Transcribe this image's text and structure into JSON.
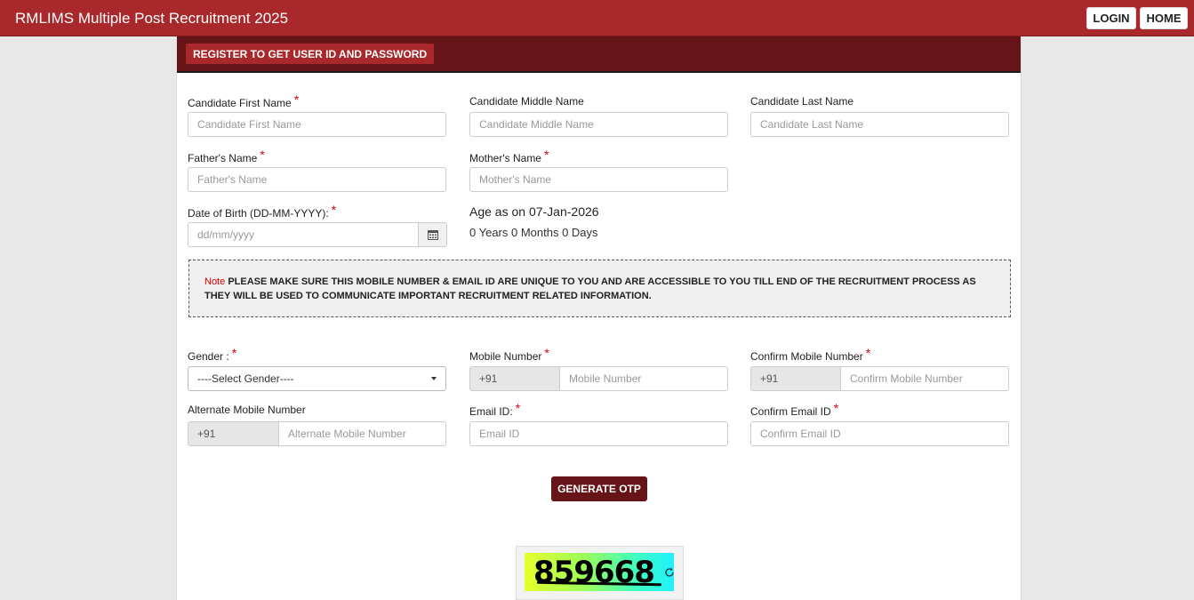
{
  "header": {
    "title": "RMLIMS Multiple Post Recruitment 2025",
    "login_label": "LOGIN",
    "home_label": "HOME"
  },
  "card": {
    "heading": "REGISTER TO GET USER ID AND PASSWORD"
  },
  "form": {
    "first_name": {
      "label": "Candidate First Name",
      "placeholder": "Candidate First Name",
      "required": "*"
    },
    "middle_name": {
      "label": "Candidate Middle Name",
      "placeholder": "Candidate Middle Name"
    },
    "last_name": {
      "label": "Candidate Last Name",
      "placeholder": "Candidate Last Name"
    },
    "father_name": {
      "label": "Father's Name",
      "placeholder": "Father's Name",
      "required": "*"
    },
    "mother_name": {
      "label": "Mother's Name",
      "placeholder": "Mother's Name",
      "required": "*"
    },
    "dob": {
      "label": "Date of Birth (DD-MM-YYYY):",
      "placeholder": "dd/mm/yyyy",
      "required": "*"
    },
    "age": {
      "title": "Age as on 07-Jan-2026",
      "value": "0 Years 0 Months 0 Days"
    },
    "note": {
      "label": "Note",
      "text": "PLEASE MAKE SURE THIS MOBILE NUMBER & EMAIL ID ARE UNIQUE TO YOU AND ARE ACCESSIBLE TO YOU TILL END OF THE RECRUITMENT PROCESS AS THEY WILL BE USED TO COMMUNICATE IMPORTANT RECRUITMENT RELATED INFORMATION."
    },
    "gender": {
      "label": "Gender :",
      "selected": "----Select Gender----",
      "required": "*"
    },
    "mobile": {
      "label": "Mobile Number",
      "prefix": "+91",
      "placeholder": "Mobile Number",
      "required": "*"
    },
    "confirm_mobile": {
      "label": "Confirm Mobile Number",
      "prefix": "+91",
      "placeholder": "Confirm Mobile Number",
      "required": "*"
    },
    "alt_mobile": {
      "label": "Alternate Mobile Number",
      "prefix": "+91",
      "placeholder": "Alternate Mobile Number"
    },
    "email": {
      "label": "Email ID:",
      "placeholder": "Email ID",
      "required": "*"
    },
    "confirm_email": {
      "label": "Confirm Email ID",
      "placeholder": "Confirm Email ID",
      "required": "*"
    },
    "otp_button": "GENERATE OTP",
    "captcha_text": "859668"
  },
  "icons": {
    "calendar": "calendar-icon",
    "refresh": "refresh-icon",
    "dropdown": "chevron-down-icon"
  },
  "colors": {
    "topbar": "#a8282b",
    "card_header": "#661418",
    "required": "#dd0000"
  }
}
